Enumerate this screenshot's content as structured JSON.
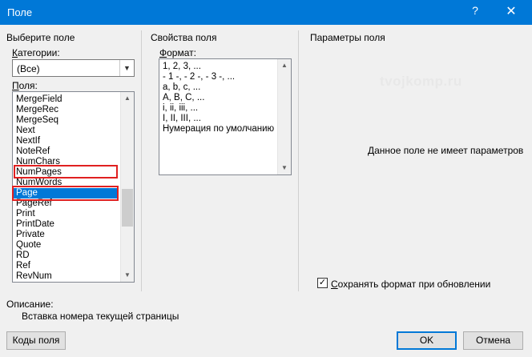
{
  "window": {
    "title": "Поле",
    "help_glyph": "?",
    "close_glyph": "✕"
  },
  "left": {
    "heading": "Выберите поле",
    "categories_label": "Категории:",
    "categories_value": "(Все)",
    "fields_label": "Поля:",
    "fields": [
      "MergeField",
      "MergeRec",
      "MergeSeq",
      "Next",
      "NextIf",
      "NoteRef",
      "NumChars",
      "NumPages",
      "NumWords",
      "Page",
      "PageRef",
      "Print",
      "PrintDate",
      "Private",
      "Quote",
      "RD",
      "Ref",
      "RevNum"
    ],
    "selected_field": "Page",
    "highlighted_fields": [
      "NumPages",
      "Page"
    ]
  },
  "middle": {
    "heading": "Свойства поля",
    "format_label": "Формат:",
    "formats": [
      "1, 2, 3, ...",
      "- 1 -, - 2 -, - 3 -, ...",
      "a, b, c, ...",
      "A, B, C, ...",
      "i, ii, iii, ...",
      "I, II, III, ...",
      "Нумерация по умолчанию"
    ]
  },
  "right": {
    "heading": "Параметры поля",
    "watermark": "tvojkomp.ru",
    "no_params": "Данное поле не имеет параметров",
    "preserve_format_label": "Сохранять формат при обновлении",
    "preserve_format_checked": true
  },
  "description": {
    "label": "Описание:",
    "text": "Вставка номера текущей страницы"
  },
  "buttons": {
    "field_codes": "Коды поля",
    "ok": "OK",
    "cancel": "Отмена"
  }
}
